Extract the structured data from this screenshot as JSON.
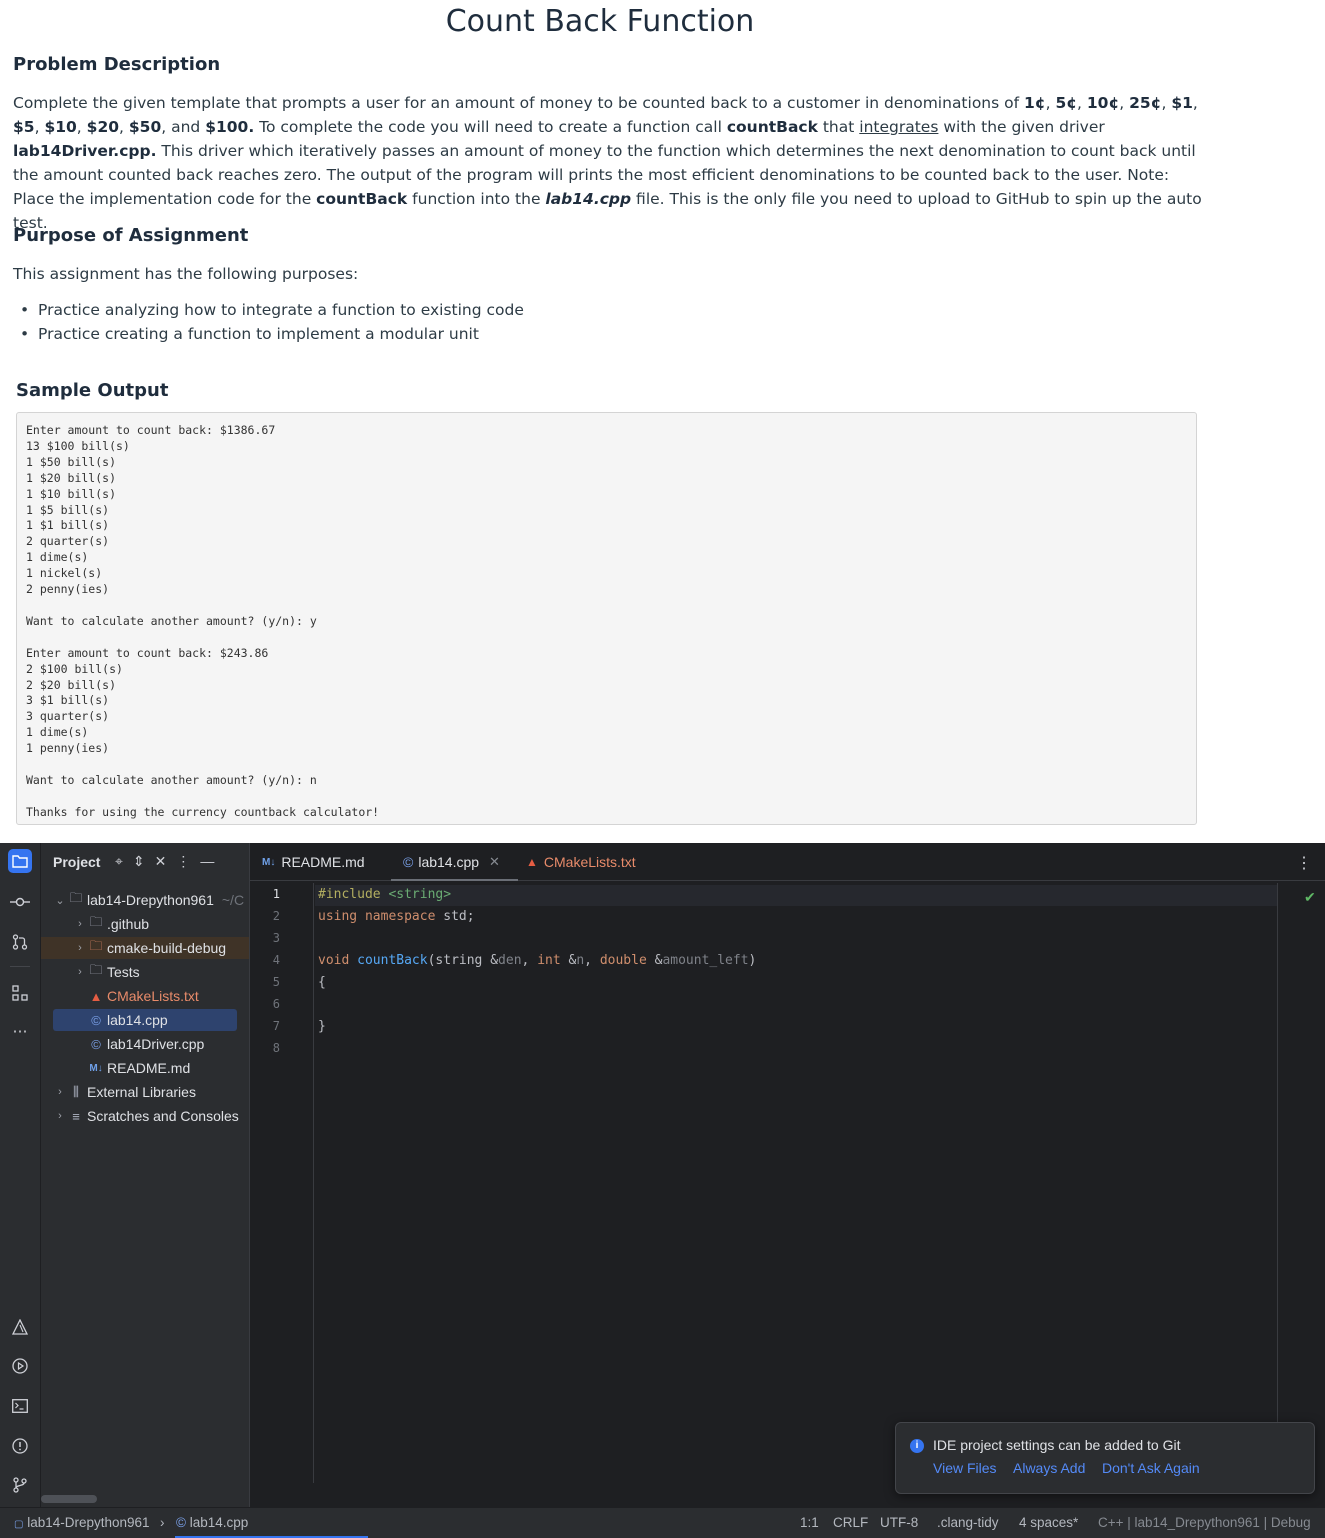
{
  "doc": {
    "title": "Count Back Function",
    "problem_heading": "Problem Description",
    "problem_parts": {
      "p1": "Complete the given template that prompts a user for an amount of money to be counted back to a customer in denominations of ",
      "b1": "1¢",
      "s1": ", ",
      "b2": "5¢",
      "s2": ", ",
      "b3": "10¢",
      "s3": ", ",
      "b4": "25¢",
      "s4": ", ",
      "b5": "$1",
      "s5": ", ",
      "b6": "$5",
      "s6": ", ",
      "b7": "$10",
      "s7": ", ",
      "b8": "$20",
      "s8": ", ",
      "b9": "$50",
      "s9": ", and ",
      "b10": "$100.",
      "p2": " To complete the code you will need to create a function call ",
      "b11": "countBack",
      "p3": " that ",
      "u1": "integrates",
      "p4": " with the given driver ",
      "b12": "lab14Driver.cpp.",
      "p5": " This driver which iteratively passes an amount of money to the function which determines the next denomination to count back until the amount counted back reaches zero. The output of the program will prints the most efficient denominations to be counted back to the user. Note: Place the implementation code for the ",
      "b13": "countBack",
      "p6": " function into the ",
      "bi1": "lab14.cpp",
      "p7": " file. This is the only file you need to upload to GitHub to spin up the auto test."
    },
    "purpose_heading": "Purpose of Assignment",
    "purpose_intro": "This assignment has the following purposes:",
    "bullets": [
      "Practice analyzing how to integrate a function to existing code",
      "Practice creating a function to implement a modular unit"
    ],
    "sample_heading": "Sample Output",
    "sample_output": "Enter amount to count back: $1386.67\n13 $100 bill(s)\n1 $50 bill(s)\n1 $20 bill(s)\n1 $10 bill(s)\n1 $5 bill(s)\n1 $1 bill(s)\n2 quarter(s)\n1 dime(s)\n1 nickel(s)\n2 penny(ies)\n\nWant to calculate another amount? (y/n): y\n\nEnter amount to count back: $243.86\n2 $100 bill(s)\n2 $20 bill(s)\n3 $1 bill(s)\n3 quarter(s)\n1 dime(s)\n1 penny(ies)\n\nWant to calculate another amount? (y/n): n\n\nThanks for using the currency countback calculator!"
  },
  "ide": {
    "project_panel_title": "Project",
    "tree": {
      "root": "lab14-Drepython961",
      "root_path": "~/C",
      "github": ".github",
      "cmake_build": "cmake-build-debug",
      "tests": "Tests",
      "cmakelists": "CMakeLists.txt",
      "lab14": "lab14.cpp",
      "driver": "lab14Driver.cpp",
      "readme": "README.md",
      "ext_libs": "External Libraries",
      "scratches": "Scratches and Consoles"
    },
    "tabs": {
      "readme": "README.md",
      "lab14": "lab14.cpp",
      "cmake": "CMakeLists.txt"
    },
    "line_numbers": [
      "1",
      "2",
      "3",
      "4",
      "5",
      "6",
      "7",
      "8"
    ],
    "code": {
      "l1_pp": "#include ",
      "l1_str": "<string>",
      "l2_kw1": "using",
      "l2_sp1": " ",
      "l2_kw2": "namespace",
      "l2_rest": " std;",
      "l4_kw": "void",
      "l4_sp": " ",
      "l4_fn": "countBack",
      "l4_a": "(string &",
      "l4_p1": "den",
      "l4_b": ", ",
      "l4_kw2": "int",
      "l4_c": " &",
      "l4_p2": "n",
      "l4_d": ", ",
      "l4_kw3": "double",
      "l4_e": " &",
      "l4_p3": "amount_left",
      "l4_f": ")",
      "l5": "{",
      "l7": "}"
    },
    "notification": {
      "message": "IDE project settings can be added to Git",
      "view_files": "View Files",
      "always_add": "Always Add",
      "dont_ask": "Don't Ask Again"
    },
    "status": {
      "project": "lab14-Drepython961",
      "file": "lab14.cpp",
      "position": "1:1",
      "line_ending": "CRLF",
      "encoding": "UTF-8",
      "linter": ".clang-tidy",
      "indent": "4 spaces*",
      "context": "C++ | lab14_Drepython961 | Debug"
    },
    "colors": {
      "accent": "#3574f0",
      "cmake_red": "#e55d43",
      "keyword": "#cf8e6d",
      "function": "#56a8f5",
      "string": "#6aab73"
    }
  }
}
